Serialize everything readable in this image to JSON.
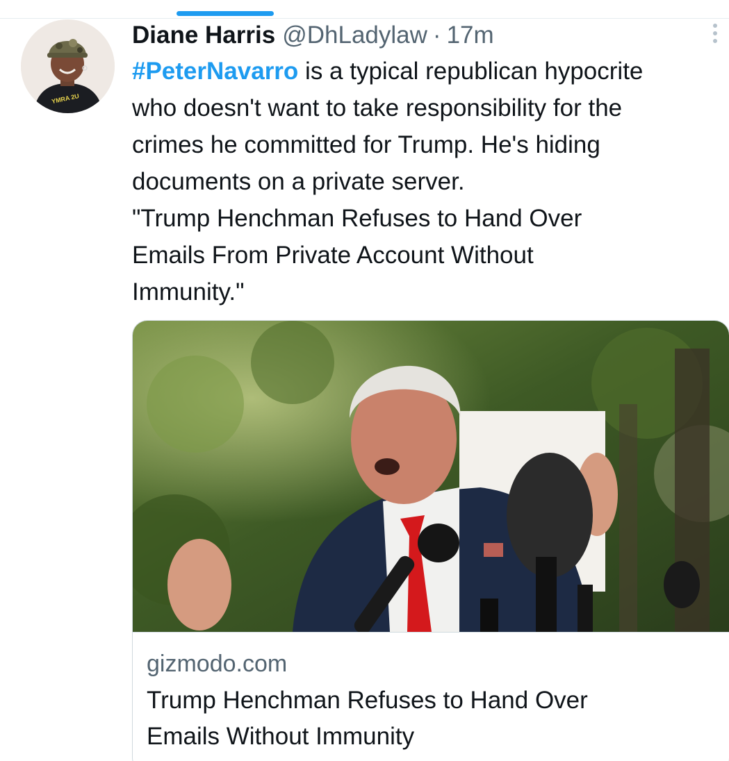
{
  "author": {
    "name": "Diane Harris",
    "handle": "@DhLadylaw",
    "separator": "·",
    "time": "17m",
    "avatar_icon": "profile-photo"
  },
  "tweet": {
    "hashtag": "#PeterNavarro",
    "lines": [
      " is a typical republican hypocrite",
      "who doesn't want to take responsibility for the",
      "crimes he committed for Trump. He's hiding",
      "documents on a private server.",
      "\"Trump Henchman Refuses to Hand Over",
      "Emails From Private Account Without",
      "Immunity.\""
    ]
  },
  "card": {
    "domain": "gizmodo.com",
    "title_lines": [
      "Trump Henchman Refuses to Hand Over",
      "Emails Without Immunity"
    ],
    "image_icon": "news-photo"
  },
  "colors": {
    "accent": "#1d9bf0",
    "text": "#0f1419",
    "secondary": "#536471",
    "border": "#cfd9de"
  },
  "icons": {
    "more": "more-vertical-icon"
  }
}
